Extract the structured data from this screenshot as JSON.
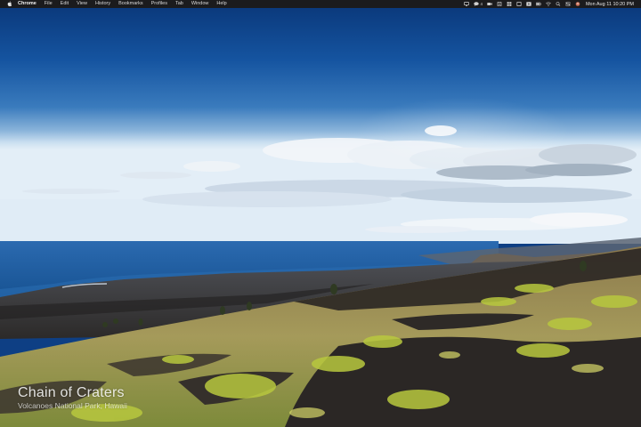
{
  "menubar": {
    "app_name": "Chrome",
    "items": [
      "File",
      "Edit",
      "View",
      "History",
      "Bookmarks",
      "Profiles",
      "Tab",
      "Window",
      "Help"
    ],
    "status": {
      "notification_count": "4",
      "icons": [
        "screen-mirror-icon",
        "chat-icon",
        "camera-icon",
        "clipboard-icon",
        "grid-icon",
        "box-icon",
        "play-icon",
        "battery-icon",
        "wifi-icon",
        "search-icon",
        "control-center-icon",
        "user-icon"
      ],
      "datetime": "Mon Aug 11  10:20 PM"
    }
  },
  "wallpaper": {
    "title": "Chain of Craters",
    "subtitle": "Volcanoes National Park, Hawaii",
    "colors": {
      "sky_top": "#0b3c80",
      "sky_mid": "#4a86c0",
      "horizon": "#cfe0ef",
      "ocean": "#1e5fa3",
      "lava": "#2f2b28",
      "grass": "#b9c24a"
    }
  }
}
